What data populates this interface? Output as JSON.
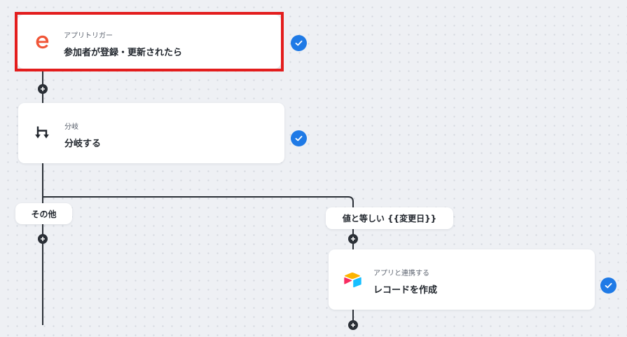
{
  "flow": {
    "trigger": {
      "subtitle": "アプリトリガー",
      "title": "参加者が登録・更新されたら",
      "icon": "eventbrite-logo-icon",
      "status": "complete"
    },
    "branch": {
      "subtitle": "分岐",
      "title": "分岐する",
      "icon": "branch-icon",
      "status": "complete"
    },
    "branch_paths": {
      "other_label": "その他",
      "condition_label": "値と等しい {{変更日}}"
    },
    "action": {
      "subtitle": "アプリと連携する",
      "title": "レコードを作成",
      "icon": "airtable-logo-icon",
      "status": "complete"
    }
  },
  "colors": {
    "selection_border": "#e31d1d",
    "check_badge": "#1f7ae6",
    "line": "#2a2f36",
    "eventbrite_orange": "#f05537"
  }
}
